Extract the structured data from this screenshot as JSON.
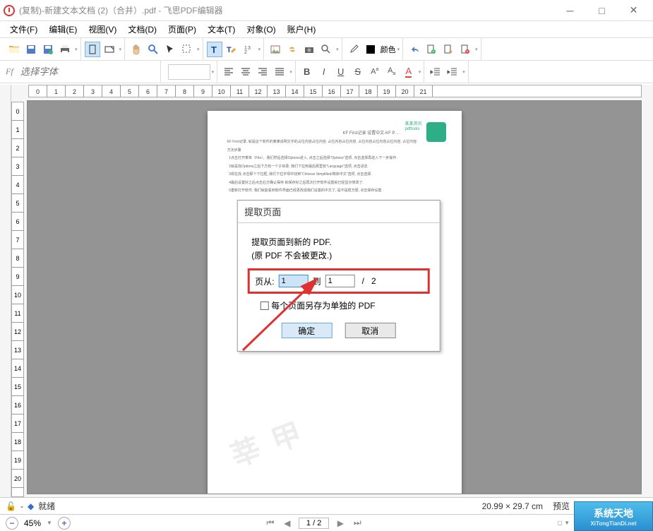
{
  "window": {
    "title": "(复制)-新建文本文档 (2)（合并）.pdf - 飞思PDF编辑器"
  },
  "menu": {
    "file": "文件(F)",
    "edit": "编辑(E)",
    "view": "视图(V)",
    "document": "文档(D)",
    "page": "页面(P)",
    "text": "文本(T)",
    "object": "对象(O)",
    "account": "账户(H)"
  },
  "toolbar": {
    "font_placeholder": "选择字体",
    "color_label": "颜色"
  },
  "ruler_h": [
    "0",
    "1",
    "2",
    "3",
    "4",
    "5",
    "6",
    "7",
    "8",
    "9",
    "10",
    "11",
    "12",
    "13",
    "14",
    "15",
    "16",
    "17",
    "18",
    "19",
    "20",
    "21"
  ],
  "ruler_v": [
    "0",
    "1",
    "2",
    "3",
    "4",
    "5",
    "6",
    "7",
    "8",
    "9",
    "10",
    "11",
    "12",
    "13",
    "14",
    "15",
    "16",
    "17",
    "18",
    "19",
    "20"
  ],
  "dialog": {
    "title": "提取页面",
    "line1": "提取页面到新的 PDF.",
    "line2": "(原 PDF 不会被更改.)",
    "from_label": "页从:",
    "from_value": "1",
    "to_label": "到",
    "to_value": "1",
    "slash": "/",
    "total": "2",
    "checkbox_label": "每个页面另存为单独的 PDF",
    "ok": "确定",
    "cancel": "取消"
  },
  "status": {
    "ready": "就绪",
    "dimensions": "20.99 × 29.7 cm",
    "preview": "预览"
  },
  "zoom": {
    "percent": "45%",
    "page": "1 / 2"
  },
  "brand": {
    "cn": "系统天地",
    "en": "XiTongTianDi.net"
  }
}
